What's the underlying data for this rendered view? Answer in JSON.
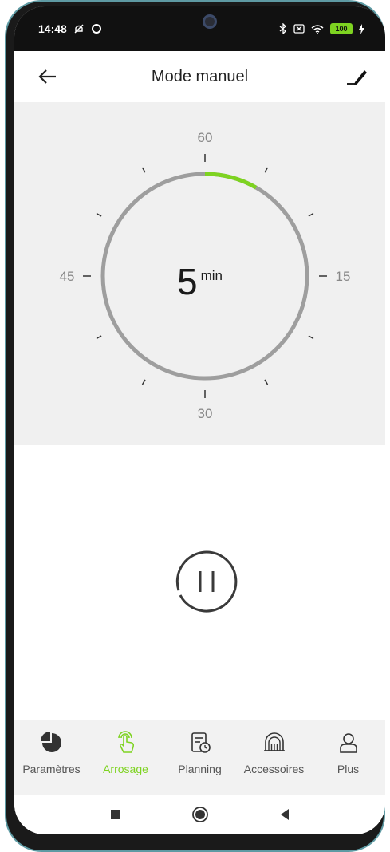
{
  "status_bar": {
    "time": "14:48",
    "battery": "100",
    "icons": [
      "mute-icon",
      "ring-icon",
      "bluetooth-icon",
      "sim-off-icon",
      "wifi-icon",
      "battery-icon",
      "charging-icon"
    ]
  },
  "header": {
    "title": "Mode manuel",
    "back_icon": "arrow-left-icon",
    "edit_icon": "pencil-icon"
  },
  "dial": {
    "label_top": "60",
    "label_right": "15",
    "label_bottom": "30",
    "label_left": "45",
    "value": "5",
    "unit": "min",
    "progress_minutes": 5,
    "max_minutes": 60,
    "progress_color": "#7ed321",
    "ring_color": "#9e9e9e"
  },
  "controls": {
    "pause_icon": "pause-icon"
  },
  "tabs": [
    {
      "label": "Paramètres",
      "icon": "pie-chart-icon",
      "active": false
    },
    {
      "label": "Arrosage",
      "icon": "tap-hand-icon",
      "active": true
    },
    {
      "label": "Planning",
      "icon": "schedule-icon",
      "active": false
    },
    {
      "label": "Accessoires",
      "icon": "accessories-icon",
      "active": false
    },
    {
      "label": "Plus",
      "icon": "user-icon",
      "active": false
    }
  ],
  "colors": {
    "accent": "#7ed321",
    "panel_background": "#f0f0f0",
    "tab_background": "#f2f2f2"
  }
}
